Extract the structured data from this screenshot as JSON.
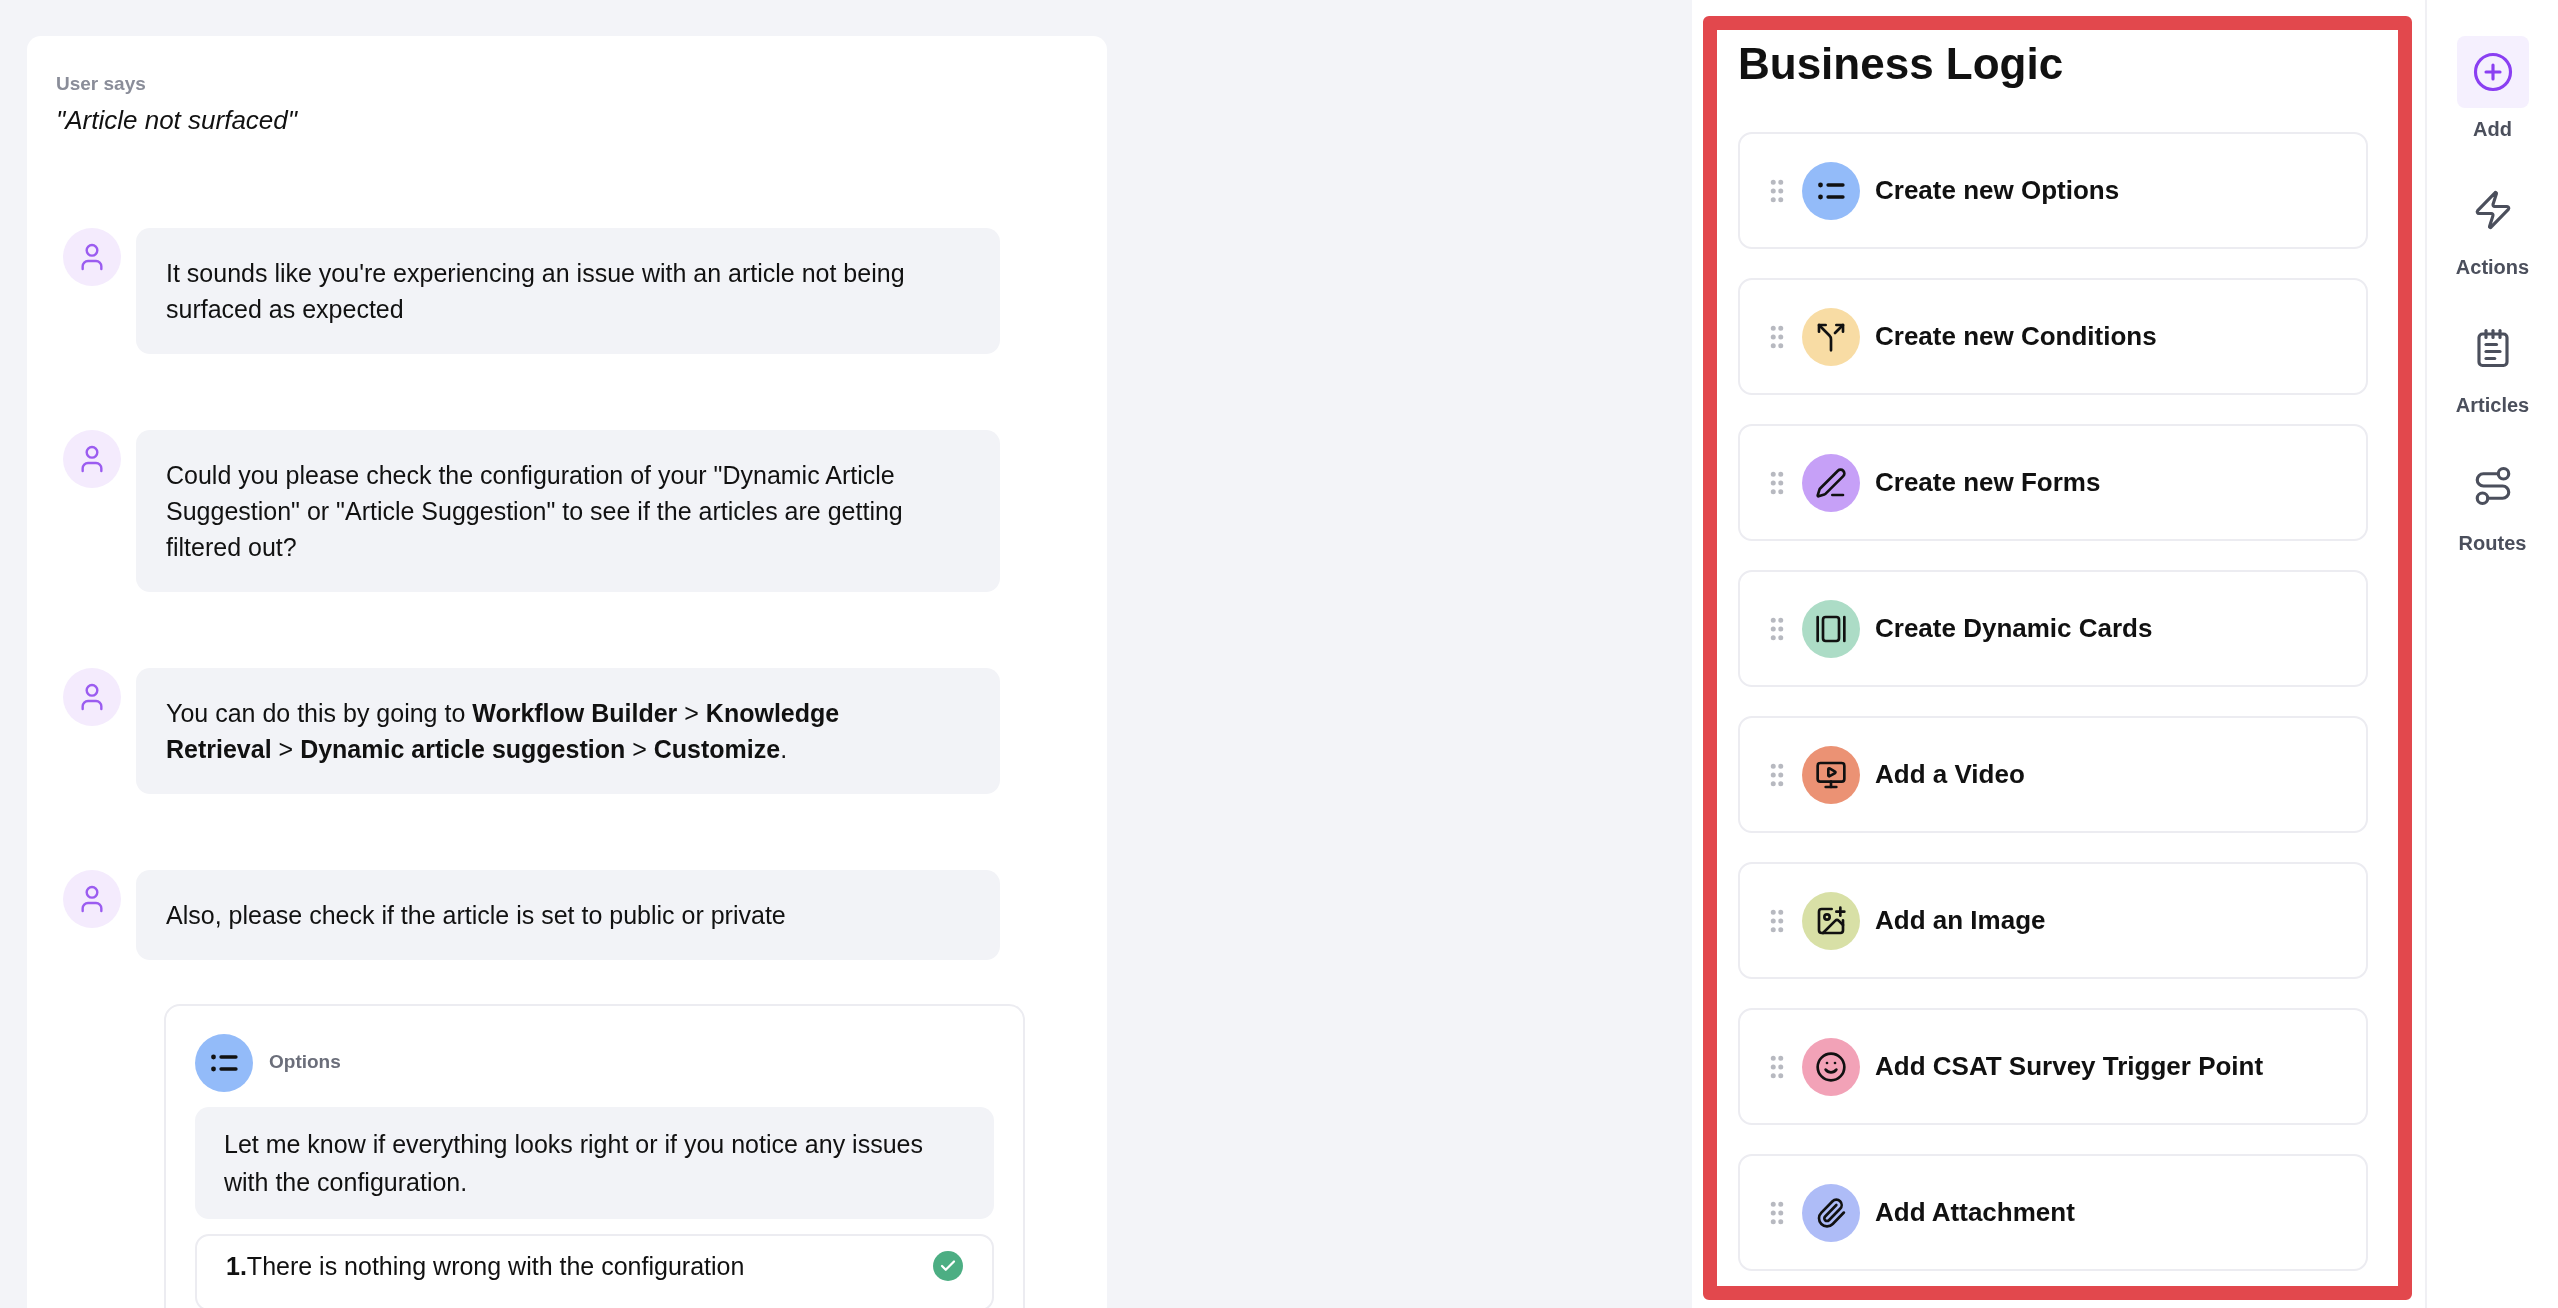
{
  "conversation": {
    "user_label": "User says",
    "user_quote": "\"Article not surfaced\"",
    "messages": [
      "It sounds like you're experiencing an issue with an article not being surfaced as expected",
      "Could you please check the configuration of your \"Dynamic Article Suggestion\" or \"Article Suggestion\" to see if the articles are getting filtered out?",
      "You can do this by going to **Workflow Builder** > **Knowledge Retrieval** > **Dynamic article suggestion** > **Customize**.",
      "Also, please check if the article is set to public or private"
    ],
    "options_card": {
      "title": "Options",
      "message": "Let me know if everything looks right or if you notice any issues with the configuration.",
      "options": [
        {
          "number": "1.",
          "text": "There is nothing wrong with the configuration",
          "checked": true
        }
      ]
    }
  },
  "business_logic": {
    "title": "Business Logic",
    "items": [
      {
        "label": "Create new Options",
        "color": "#93bbf9"
      },
      {
        "label": "Create new Conditions",
        "color": "#f8dca4"
      },
      {
        "label": "Create new Forms",
        "color": "#c6a0f7"
      },
      {
        "label": "Create Dynamic Cards",
        "color": "#acdcc6"
      },
      {
        "label": "Add a Video",
        "color": "#eb9274"
      },
      {
        "label": "Add an Image",
        "color": "#d8e0a6"
      },
      {
        "label": "Add CSAT Survey Trigger Point",
        "color": "#f2a2b7"
      },
      {
        "label": "Add Attachment",
        "color": "#aebcf7"
      }
    ]
  },
  "sidebar": {
    "items": [
      {
        "label": "Add",
        "selected": true
      },
      {
        "label": "Actions",
        "selected": false
      },
      {
        "label": "Articles",
        "selected": false
      },
      {
        "label": "Routes",
        "selected": false
      }
    ]
  }
}
